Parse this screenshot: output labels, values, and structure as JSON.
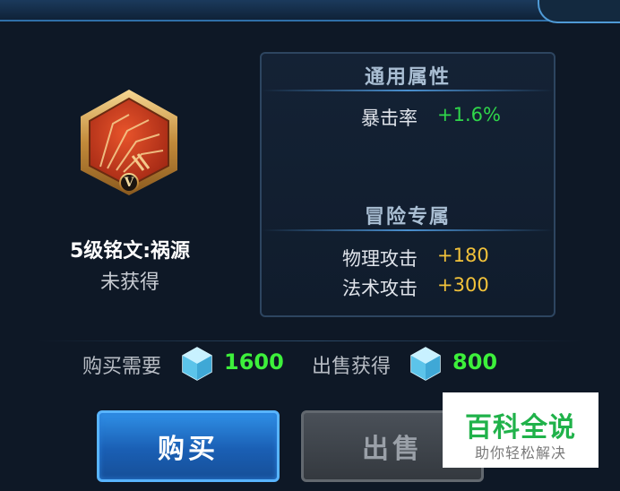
{
  "rune": {
    "name": "5级铭文:祸源",
    "status": "未获得",
    "level_roman": "V"
  },
  "panel": {
    "general_title": "通用属性",
    "general_stats": [
      {
        "name": "暴击率",
        "value": "+1.6%",
        "color": "#2fd64a"
      }
    ],
    "adventure_title": "冒险专属",
    "adventure_stats": [
      {
        "name": "物理攻击",
        "value": "+180",
        "color": "#f2c23a"
      },
      {
        "name": "法术攻击",
        "value": "+300",
        "color": "#f2c23a"
      }
    ]
  },
  "price": {
    "buy_label": "购买需要",
    "buy_value": "1600",
    "sell_label": "出售获得",
    "sell_value": "800",
    "currency_icon": "diamond-gem-icon"
  },
  "buttons": {
    "buy_label": "购买",
    "sell_label": "出售"
  },
  "watermark": {
    "title": "百科全说",
    "subtitle": "助你轻松解决"
  },
  "colors": {
    "value_green": "#3df03b",
    "buy_button": "#1a5fb4",
    "sell_button": "#3a3f45"
  }
}
